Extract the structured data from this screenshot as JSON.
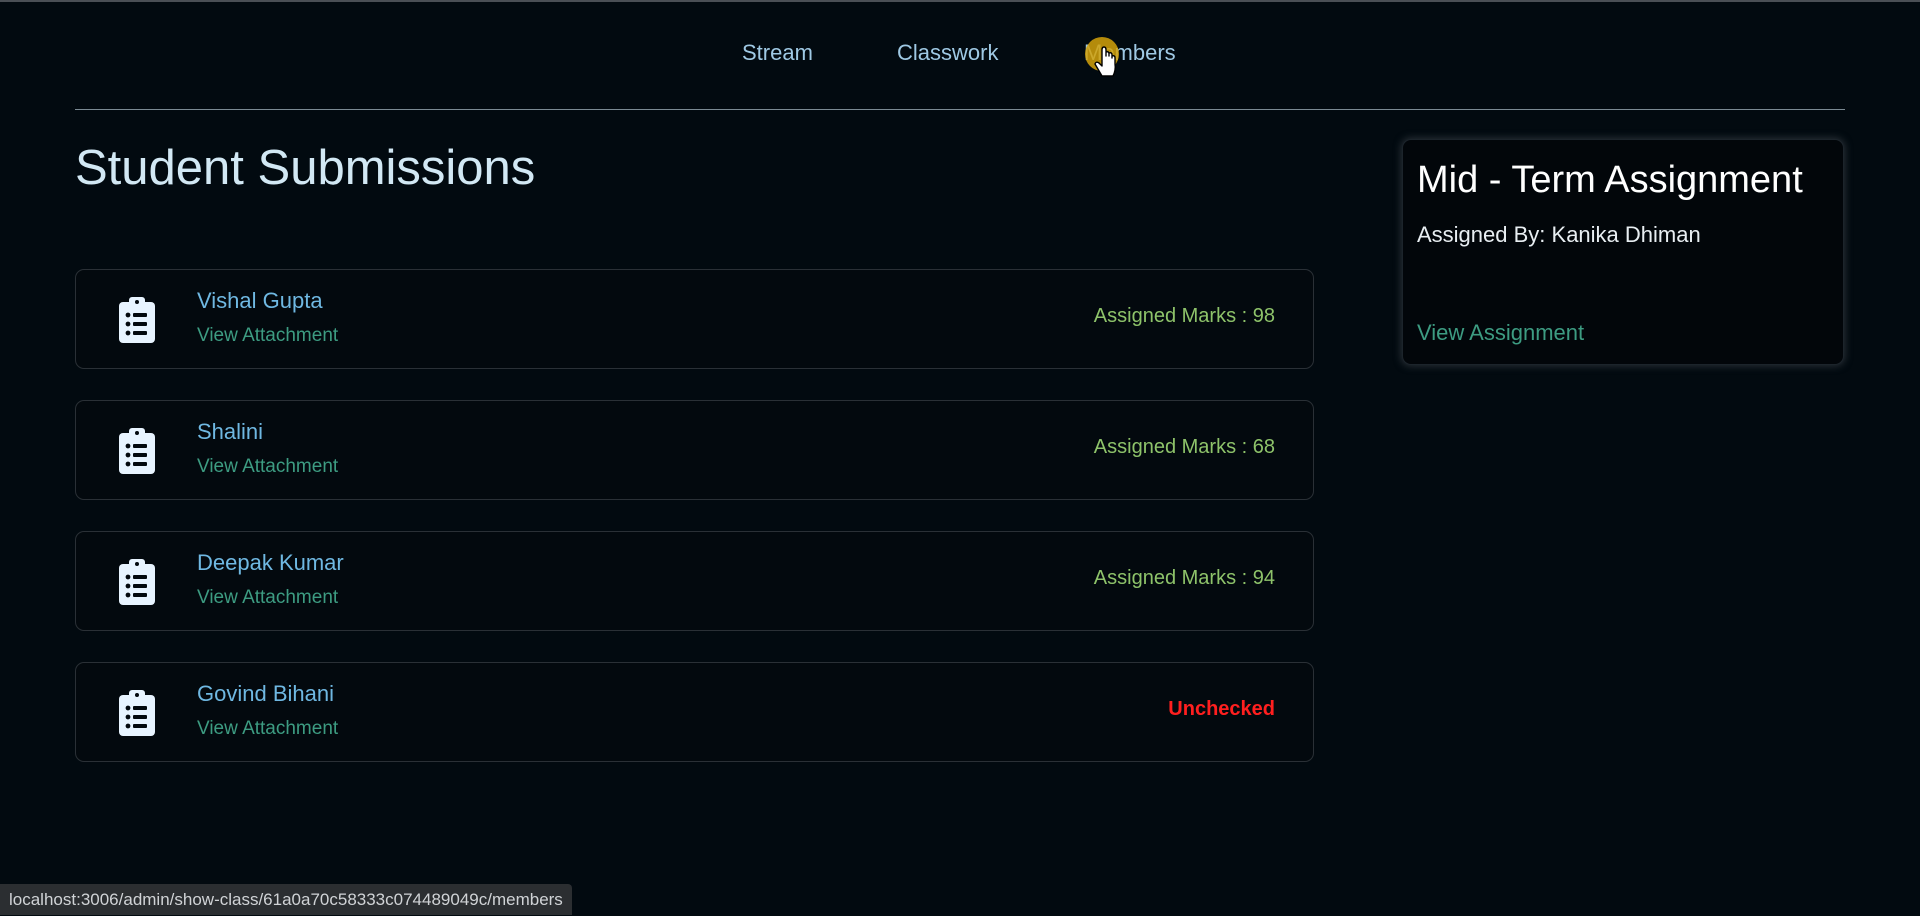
{
  "nav": {
    "tabs": [
      {
        "label": "Stream"
      },
      {
        "label": "Classwork"
      },
      {
        "label": "Members"
      }
    ]
  },
  "page": {
    "title": "Student Submissions"
  },
  "submissions": [
    {
      "name": "Vishal Gupta",
      "attachment": "View Attachment",
      "status": "Assigned Marks : 98"
    },
    {
      "name": "Shalini",
      "attachment": "View Attachment",
      "status": "Assigned Marks : 68"
    },
    {
      "name": "Deepak Kumar",
      "attachment": "View Attachment",
      "status": "Assigned Marks : 94"
    },
    {
      "name": "Govind Bihani",
      "attachment": "View Attachment",
      "status": "Unchecked"
    }
  ],
  "assignment": {
    "title": "Mid - Term Assignment",
    "assigned_by": "Assigned By: Kanika Dhiman",
    "view_link": "View Assignment"
  },
  "status_bar": {
    "url": "localhost:3006/admin/show-class/61a0a70c58333c074489049c/members"
  },
  "icons": {
    "submission_icon": "clipboard-list-icon"
  },
  "colors": {
    "background": "#020a10",
    "accent_link": "#3d9c82",
    "name_link": "#6fb8e2",
    "marks": "#8ec36a",
    "unchecked": "#ff1f1f"
  }
}
